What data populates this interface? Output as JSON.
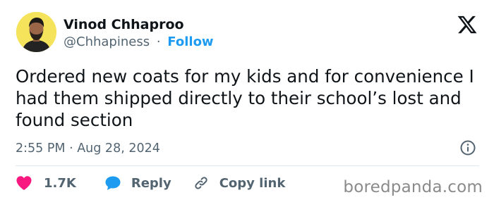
{
  "author": {
    "name": "Vinod Chhaproo",
    "handle": "@Chhapiness",
    "separator": "·",
    "follow_label": "Follow",
    "avatar_icon": "profile-photo"
  },
  "platform": {
    "logo_icon": "x-logo"
  },
  "tweet": {
    "text": "Ordered new coats for my kids and for convenience I had them shipped directly to their school’s lost and found section",
    "timestamp": "2:55 PM · Aug 28, 2024",
    "info_icon": "info-icon"
  },
  "actions": {
    "like": {
      "count": "1.7K",
      "icon": "heart-icon",
      "color": "#f91880"
    },
    "reply": {
      "label": "Reply",
      "icon": "speech-bubble-icon",
      "color": "#1d9bf0"
    },
    "copy_link": {
      "label": "Copy link",
      "icon": "link-icon"
    }
  },
  "watermark": {
    "text": "boredpanda.com"
  },
  "colors": {
    "accent": "#1d9bf0",
    "text_primary": "#0f1419",
    "text_secondary": "#536471",
    "avatar_bg": "#f4e35b",
    "divider": "#e1e8ed"
  }
}
